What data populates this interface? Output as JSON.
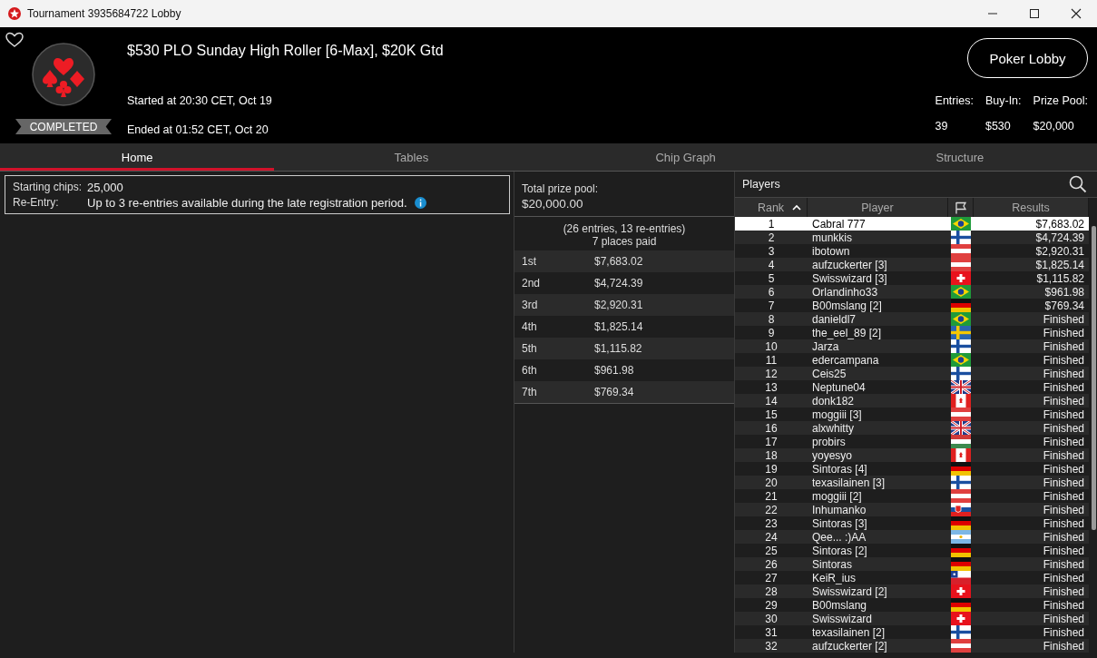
{
  "window": {
    "title": "Tournament 3935684722 Lobby"
  },
  "header": {
    "tournament_name": "$530 PLO Sunday High Roller [6-Max], $20K Gtd",
    "status": "COMPLETED",
    "started": "Started at 20:30 CET, Oct 19",
    "ended": "Ended at 01:52 CET, Oct 20",
    "button": "Poker Lobby",
    "favorite": false,
    "stats": [
      {
        "label": "Entries:",
        "value": "39"
      },
      {
        "label": "Buy-In:",
        "value": "$530"
      },
      {
        "label": "Prize Pool:",
        "value": "$20,000"
      }
    ]
  },
  "tabs": [
    {
      "label": "Home",
      "selected": true
    },
    {
      "label": "Tables",
      "selected": false
    },
    {
      "label": "Chip Graph",
      "selected": false
    },
    {
      "label": "Structure",
      "selected": false
    }
  ],
  "info": [
    {
      "label": "Starting chips:",
      "value": "25,000",
      "info_icon": false
    },
    {
      "label": "Re-Entry:",
      "value": "Up to 3 re-entries available during the late registration period.",
      "info_icon": true
    }
  ],
  "prize_pool": {
    "label": "Total prize pool:",
    "amount": "$20,000.00",
    "entries_note": "(26 entries, 13 re-entries)",
    "places_paid": "7 places paid",
    "payouts": [
      {
        "place": "1st",
        "amount": "$7,683.02"
      },
      {
        "place": "2nd",
        "amount": "$4,724.39"
      },
      {
        "place": "3rd",
        "amount": "$2,920.31"
      },
      {
        "place": "4th",
        "amount": "$1,825.14"
      },
      {
        "place": "5th",
        "amount": "$1,115.82"
      },
      {
        "place": "6th",
        "amount": "$961.98"
      },
      {
        "place": "7th",
        "amount": "$769.34"
      }
    ]
  },
  "players": {
    "title": "Players",
    "columns": [
      "Rank",
      "Player",
      "Results"
    ],
    "rows": [
      {
        "rank": "1",
        "player": "Cabral 777",
        "kind": "br",
        "result": "$7,683.02",
        "selected": true
      },
      {
        "rank": "2",
        "player": "munkkis",
        "kind": "fi",
        "result": "$4,724.39",
        "selected": false
      },
      {
        "rank": "3",
        "player": "ibotown",
        "kind": "at",
        "result": "$2,920.31",
        "selected": false
      },
      {
        "rank": "4",
        "player": "aufzuckerter [3]",
        "kind": "at",
        "result": "$1,825.14",
        "selected": false
      },
      {
        "rank": "5",
        "player": "Swisswizard [3]",
        "kind": "ch",
        "result": "$1,115.82",
        "selected": false
      },
      {
        "rank": "6",
        "player": "Orlandinho33",
        "kind": "br",
        "result": "$961.98",
        "selected": false
      },
      {
        "rank": "7",
        "player": "B00mslang [2]",
        "kind": "de",
        "result": "$769.34",
        "selected": false
      },
      {
        "rank": "8",
        "player": "danieldl7",
        "kind": "br",
        "result": "Finished",
        "selected": false
      },
      {
        "rank": "9",
        "player": "the_eel_89 [2]",
        "kind": "se",
        "result": "Finished",
        "selected": false
      },
      {
        "rank": "10",
        "player": "Jarza",
        "kind": "fi",
        "result": "Finished",
        "selected": false
      },
      {
        "rank": "11",
        "player": "edercampana",
        "kind": "br",
        "result": "Finished",
        "selected": false
      },
      {
        "rank": "12",
        "player": "Ceis25",
        "kind": "fi",
        "result": "Finished",
        "selected": false
      },
      {
        "rank": "13",
        "player": "Neptune04",
        "kind": "gb",
        "result": "Finished",
        "selected": false
      },
      {
        "rank": "14",
        "player": "donk182",
        "kind": "ca",
        "result": "Finished",
        "selected": false
      },
      {
        "rank": "15",
        "player": "moggiii [3]",
        "kind": "at",
        "result": "Finished",
        "selected": false
      },
      {
        "rank": "16",
        "player": "alxwhitty",
        "kind": "gb",
        "result": "Finished",
        "selected": false
      },
      {
        "rank": "17",
        "player": "probirs",
        "kind": "hu",
        "result": "Finished",
        "selected": false
      },
      {
        "rank": "18",
        "player": "yoyesyo",
        "kind": "ca",
        "result": "Finished",
        "selected": false
      },
      {
        "rank": "19",
        "player": "Sintoras [4]",
        "kind": "de",
        "result": "Finished",
        "selected": false
      },
      {
        "rank": "20",
        "player": "texasilainen [3]",
        "kind": "fi",
        "result": "Finished",
        "selected": false
      },
      {
        "rank": "21",
        "player": "moggiii [2]",
        "kind": "at",
        "result": "Finished",
        "selected": false
      },
      {
        "rank": "22",
        "player": "Inhumanko",
        "kind": "sk",
        "result": "Finished",
        "selected": false
      },
      {
        "rank": "23",
        "player": "Sintoras [3]",
        "kind": "de",
        "result": "Finished",
        "selected": false
      },
      {
        "rank": "24",
        "player": "Qee... :)AA",
        "kind": "ar",
        "result": "Finished",
        "selected": false
      },
      {
        "rank": "25",
        "player": "Sintoras [2]",
        "kind": "de",
        "result": "Finished",
        "selected": false
      },
      {
        "rank": "26",
        "player": "Sintoras",
        "kind": "de",
        "result": "Finished",
        "selected": false
      },
      {
        "rank": "27",
        "player": "KeiR_ius",
        "kind": "cl",
        "result": "Finished",
        "selected": false
      },
      {
        "rank": "28",
        "player": "Swisswizard [2]",
        "kind": "ch",
        "result": "Finished",
        "selected": false
      },
      {
        "rank": "29",
        "player": "B00mslang",
        "kind": "de",
        "result": "Finished",
        "selected": false
      },
      {
        "rank": "30",
        "player": "Swisswizard",
        "kind": "ch",
        "result": "Finished",
        "selected": false
      },
      {
        "rank": "31",
        "player": "texasilainen [2]",
        "kind": "fi",
        "result": "Finished",
        "selected": false
      },
      {
        "rank": "32",
        "player": "aufzuckerter [2]",
        "kind": "at",
        "result": "Finished",
        "selected": false
      }
    ]
  }
}
